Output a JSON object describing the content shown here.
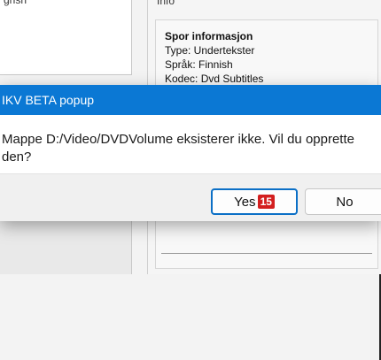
{
  "background": {
    "left_list_item": "gnsh",
    "info_title": "Info",
    "track_info": {
      "header": "Spor informasjon",
      "lines": [
        "Type: Undertekster",
        "Språk: Finnish",
        "Kodec: Dvd Subtitles"
      ]
    }
  },
  "dialog": {
    "title": "IKV BETA popup",
    "message": "Mappe D:/Video/DVDVolume eksisterer ikke. Vil du opprette den?",
    "buttons": {
      "yes_label": "Yes",
      "yes_badge": "15",
      "no_label": "No"
    }
  },
  "colors": {
    "titlebar": "#0b78d4",
    "badge": "#d31f1f",
    "focus_border": "#0b6fc6"
  }
}
